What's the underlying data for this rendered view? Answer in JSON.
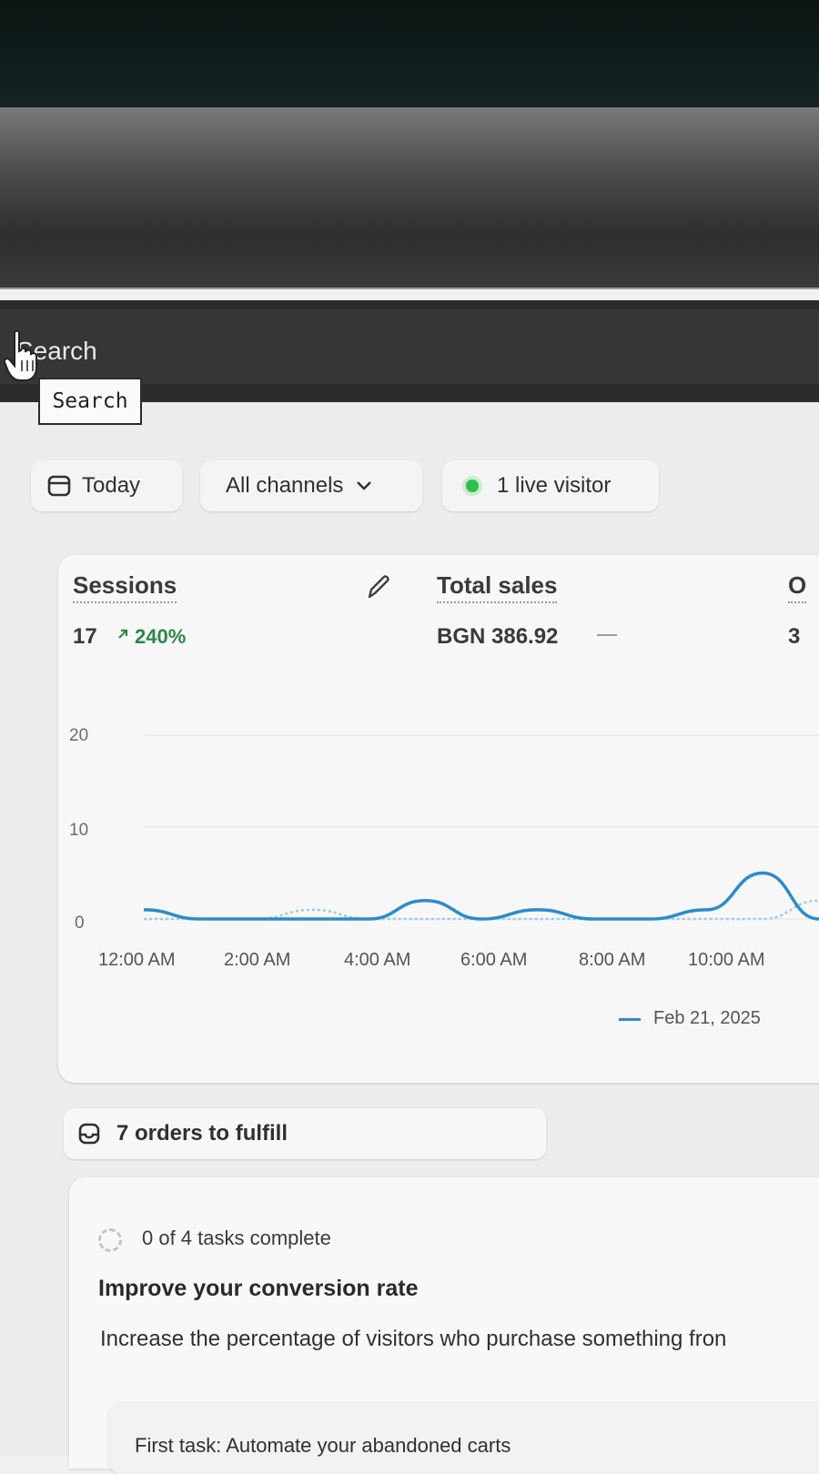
{
  "topbar": {
    "search_label": "Search",
    "search_tooltip": "Search"
  },
  "filters": {
    "date_label": "Today",
    "channels_label": "All channels",
    "live_visitors_label": "1 live visitor"
  },
  "metrics": [
    {
      "title": "Sessions",
      "value": "17",
      "change": "240%"
    },
    {
      "title": "Total sales",
      "value": "BGN 386.92",
      "change": ""
    },
    {
      "title": "O",
      "value": "3",
      "change": ""
    }
  ],
  "chart_data": {
    "type": "line",
    "title": "Sessions",
    "xlabel": "",
    "ylabel": "",
    "ylim": [
      0,
      20
    ],
    "yticks": [
      "20",
      "10",
      "0"
    ],
    "xticks": [
      "12:00 AM",
      "2:00 AM",
      "4:00 AM",
      "6:00 AM",
      "8:00 AM",
      "10:00 AM"
    ],
    "grid": true,
    "legend": "bottom-right",
    "series": [
      {
        "name": "Feb 21, 2025",
        "color": "#2a8ccc",
        "x": [
          0,
          1,
          2,
          3,
          4,
          5,
          6,
          7,
          8,
          9,
          10,
          11,
          12
        ],
        "values": [
          1,
          0,
          0,
          0,
          0,
          2,
          0,
          1,
          0,
          0,
          1,
          5,
          0
        ]
      },
      {
        "name": "",
        "color": "#9fc9e4",
        "dashed": true,
        "x": [
          0,
          1,
          2,
          3,
          4,
          5,
          6,
          7,
          8,
          9,
          10,
          11,
          12
        ],
        "values": [
          0,
          0,
          0,
          1,
          0,
          0,
          0,
          0,
          0,
          0,
          0,
          0,
          2
        ]
      }
    ]
  },
  "orders": {
    "label": "7 orders to fulfill"
  },
  "tasks": {
    "status": "0 of 4 tasks complete",
    "heading": "Improve your conversion rate",
    "description": "Increase the percentage of visitors who purchase something fron",
    "first_task": "First task: Automate your abandoned carts"
  }
}
